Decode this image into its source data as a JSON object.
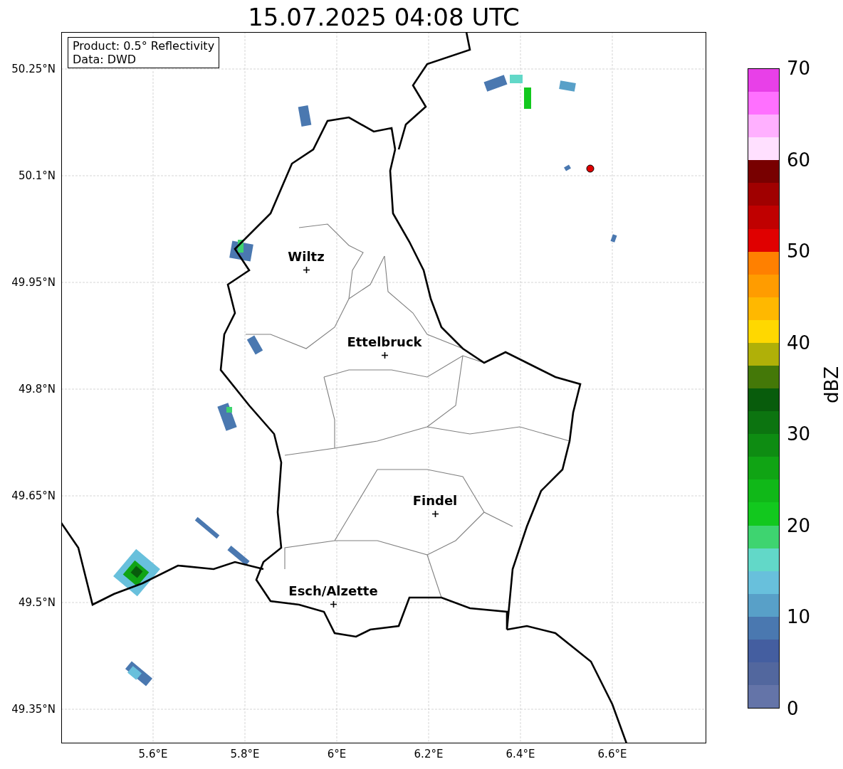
{
  "title": "15.07.2025 04:08 UTC",
  "info_box": {
    "lines": [
      "Product: 0.5° Reflectivity",
      "Data: DWD"
    ]
  },
  "map": {
    "y_ticks": [
      "50.25°N",
      "50.1°N",
      "49.95°N",
      "49.8°N",
      "49.65°N",
      "49.5°N",
      "49.35°N"
    ],
    "x_ticks": [
      "5.6°E",
      "5.8°E",
      "6°E",
      "6.2°E",
      "6.4°E",
      "6.6°E"
    ],
    "places": [
      {
        "name": "Wiltz"
      },
      {
        "name": "Ettelbruck"
      },
      {
        "name": "Findel"
      },
      {
        "name": "Esch/Alzette"
      }
    ]
  },
  "colorbar": {
    "label": "dBZ",
    "ticks": [
      "70",
      "60",
      "50",
      "40",
      "30",
      "20",
      "10",
      "0"
    ],
    "bins": [
      {
        "color": "#e840e8"
      },
      {
        "color": "#ff70ff"
      },
      {
        "color": "#ffb0ff"
      },
      {
        "color": "#ffe0ff"
      },
      {
        "color": "#780000"
      },
      {
        "color": "#a00000"
      },
      {
        "color": "#c00000"
      },
      {
        "color": "#e00000"
      },
      {
        "color": "#ff8000"
      },
      {
        "color": "#ff9c00"
      },
      {
        "color": "#ffb800"
      },
      {
        "color": "#ffd800"
      },
      {
        "color": "#b0b008"
      },
      {
        "color": "#447808"
      },
      {
        "color": "#085c0c"
      },
      {
        "color": "#0c7410"
      },
      {
        "color": "#0e8c12"
      },
      {
        "color": "#10a414"
      },
      {
        "color": "#10b818"
      },
      {
        "color": "#12c81e"
      },
      {
        "color": "#3ed470"
      },
      {
        "color": "#62d8c8"
      },
      {
        "color": "#68c0dc"
      },
      {
        "color": "#58a0c8"
      },
      {
        "color": "#4a78b0"
      },
      {
        "color": "#445ea0"
      },
      {
        "color": "#52679e"
      },
      {
        "color": "#6474a8"
      }
    ]
  }
}
